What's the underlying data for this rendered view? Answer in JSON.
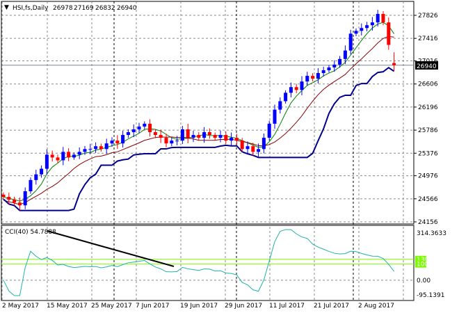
{
  "header": {
    "symbol": "HSI,fs,Daily",
    "open": "26978",
    "high": "27169",
    "low": "26832",
    "close": "26940"
  },
  "price_label": "26940",
  "cci_label": "CCI(40) 54.7888",
  "colors": {
    "up": "#0000ff",
    "down": "#ff0000",
    "ma_fast": "#008000",
    "ma_slow": "#8b0000",
    "channel": "#00008b",
    "cci": "#20b2aa",
    "levels": "#7cfc00"
  },
  "chart_data": {
    "type": "candlestick",
    "title": "HSI,fs,Daily",
    "price_ticks": [
      27826,
      27416,
      27016,
      26606,
      26196,
      25786,
      25376,
      24976,
      24566,
      24156
    ],
    "price_range": [
      24156,
      27826
    ],
    "x_labels": [
      "2 May 2017",
      "15 May 2017",
      "25 May 2017",
      "7 Jun 2017",
      "19 Jun 2017",
      "29 Jun 2017",
      "11 Jul 2017",
      "21 Jul 2017",
      "2 Aug 2017"
    ],
    "closes": [
      24600,
      24550,
      24500,
      24450,
      24700,
      24900,
      25000,
      25100,
      25350,
      25300,
      25250,
      25400,
      25300,
      25350,
      25400,
      25450,
      25450,
      25500,
      25450,
      25550,
      25600,
      25550,
      25700,
      25750,
      25800,
      25850,
      25900,
      25750,
      25700,
      25650,
      25550,
      25600,
      25600,
      25800,
      25650,
      25700,
      25650,
      25750,
      25700,
      25650,
      25700,
      25600,
      25650,
      25600,
      25450,
      25500,
      25400,
      25450,
      25650,
      25900,
      26150,
      26300,
      26450,
      26550,
      26500,
      26650,
      26750,
      26700,
      26800,
      26850,
      26900,
      26950,
      27050,
      27200,
      27500,
      27550,
      27600,
      27650,
      27700,
      27850,
      27700,
      27300,
      26940
    ],
    "last_ohlc": [
      26978,
      27169,
      26832,
      26940
    ],
    "cci": {
      "period": 40,
      "last": 54.7888,
      "ticks": [
        "314.3633",
        "130",
        "100",
        "0.00",
        "-95.1391"
      ],
      "levels": [
        130,
        100
      ]
    }
  }
}
